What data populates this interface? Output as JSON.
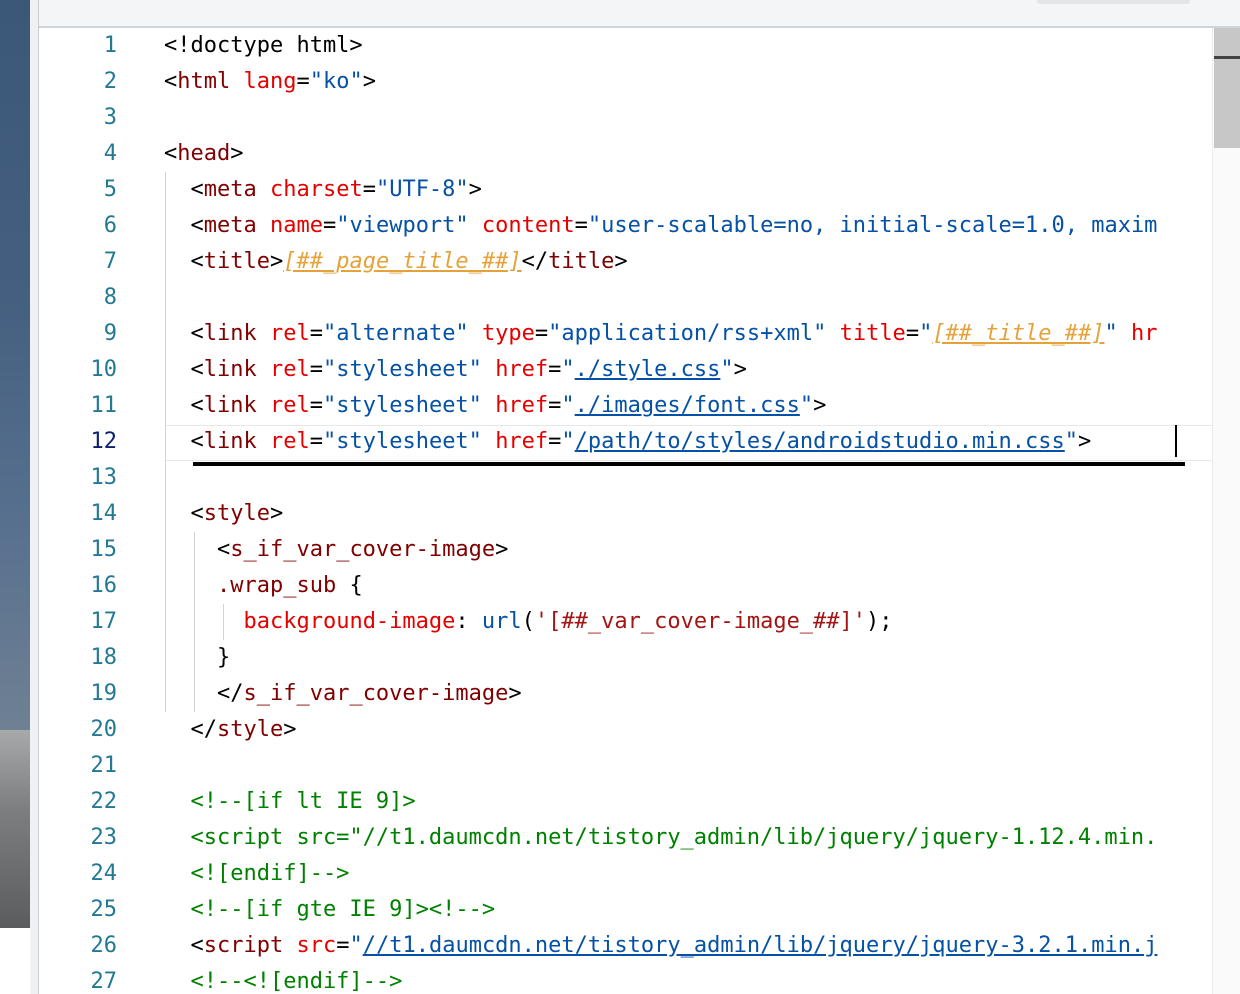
{
  "editor": {
    "lines": [
      {
        "n": "1",
        "tokens": [
          {
            "c": "k",
            "t": "<!doctype html>"
          }
        ]
      },
      {
        "n": "2",
        "tokens": [
          {
            "c": "k",
            "t": "<"
          },
          {
            "c": "t",
            "t": "html"
          },
          {
            "c": "k",
            "t": " "
          },
          {
            "c": "a",
            "t": "lang"
          },
          {
            "c": "k",
            "t": "="
          },
          {
            "c": "v",
            "t": "\"ko\""
          },
          {
            "c": "k",
            "t": ">"
          }
        ]
      },
      {
        "n": "3",
        "tokens": []
      },
      {
        "n": "4",
        "tokens": [
          {
            "c": "k",
            "t": "<"
          },
          {
            "c": "t",
            "t": "head"
          },
          {
            "c": "k",
            "t": ">"
          }
        ]
      },
      {
        "n": "5",
        "tokens": [
          {
            "c": "k",
            "t": "  <"
          },
          {
            "c": "t",
            "t": "meta"
          },
          {
            "c": "k",
            "t": " "
          },
          {
            "c": "a",
            "t": "charset"
          },
          {
            "c": "k",
            "t": "="
          },
          {
            "c": "v",
            "t": "\"UTF-8\""
          },
          {
            "c": "k",
            "t": ">"
          }
        ]
      },
      {
        "n": "6",
        "tokens": [
          {
            "c": "k",
            "t": "  <"
          },
          {
            "c": "t",
            "t": "meta"
          },
          {
            "c": "k",
            "t": " "
          },
          {
            "c": "a",
            "t": "name"
          },
          {
            "c": "k",
            "t": "="
          },
          {
            "c": "v",
            "t": "\"viewport\""
          },
          {
            "c": "k",
            "t": " "
          },
          {
            "c": "a",
            "t": "content"
          },
          {
            "c": "k",
            "t": "="
          },
          {
            "c": "v",
            "t": "\"user-scalable=no, initial-scale=1.0, maxim"
          }
        ]
      },
      {
        "n": "7",
        "tokens": [
          {
            "c": "k",
            "t": "  <"
          },
          {
            "c": "t",
            "t": "title"
          },
          {
            "c": "k",
            "t": ">"
          },
          {
            "c": "p",
            "t": "[##_page_title_##]"
          },
          {
            "c": "k",
            "t": "</"
          },
          {
            "c": "t",
            "t": "title"
          },
          {
            "c": "k",
            "t": ">"
          }
        ]
      },
      {
        "n": "8",
        "tokens": []
      },
      {
        "n": "9",
        "tokens": [
          {
            "c": "k",
            "t": "  <"
          },
          {
            "c": "t",
            "t": "link"
          },
          {
            "c": "k",
            "t": " "
          },
          {
            "c": "a",
            "t": "rel"
          },
          {
            "c": "k",
            "t": "="
          },
          {
            "c": "v",
            "t": "\"alternate\""
          },
          {
            "c": "k",
            "t": " "
          },
          {
            "c": "a",
            "t": "type"
          },
          {
            "c": "k",
            "t": "="
          },
          {
            "c": "v",
            "t": "\"application/rss+xml\""
          },
          {
            "c": "k",
            "t": " "
          },
          {
            "c": "a",
            "t": "title"
          },
          {
            "c": "k",
            "t": "="
          },
          {
            "c": "v",
            "t": "\""
          },
          {
            "c": "p",
            "t": "[##_title_##]"
          },
          {
            "c": "v",
            "t": "\""
          },
          {
            "c": "k",
            "t": " "
          },
          {
            "c": "a",
            "t": "hr"
          }
        ]
      },
      {
        "n": "10",
        "tokens": [
          {
            "c": "k",
            "t": "  <"
          },
          {
            "c": "t",
            "t": "link"
          },
          {
            "c": "k",
            "t": " "
          },
          {
            "c": "a",
            "t": "rel"
          },
          {
            "c": "k",
            "t": "="
          },
          {
            "c": "v",
            "t": "\"stylesheet\""
          },
          {
            "c": "k",
            "t": " "
          },
          {
            "c": "a",
            "t": "href"
          },
          {
            "c": "k",
            "t": "="
          },
          {
            "c": "v",
            "t": "\""
          },
          {
            "c": "l",
            "t": "./style.css"
          },
          {
            "c": "v",
            "t": "\""
          },
          {
            "c": "k",
            "t": ">"
          }
        ]
      },
      {
        "n": "11",
        "tokens": [
          {
            "c": "k",
            "t": "  <"
          },
          {
            "c": "t",
            "t": "link"
          },
          {
            "c": "k",
            "t": " "
          },
          {
            "c": "a",
            "t": "rel"
          },
          {
            "c": "k",
            "t": "="
          },
          {
            "c": "v",
            "t": "\"stylesheet\""
          },
          {
            "c": "k",
            "t": " "
          },
          {
            "c": "a",
            "t": "href"
          },
          {
            "c": "k",
            "t": "="
          },
          {
            "c": "v",
            "t": "\""
          },
          {
            "c": "l",
            "t": "./images/font.css"
          },
          {
            "c": "v",
            "t": "\""
          },
          {
            "c": "k",
            "t": ">"
          }
        ]
      },
      {
        "n": "12",
        "active": true,
        "tokens": [
          {
            "c": "k",
            "t": "  <"
          },
          {
            "c": "t",
            "t": "link"
          },
          {
            "c": "k",
            "t": " "
          },
          {
            "c": "a",
            "t": "rel"
          },
          {
            "c": "k",
            "t": "="
          },
          {
            "c": "v",
            "t": "\"stylesheet\""
          },
          {
            "c": "k",
            "t": " "
          },
          {
            "c": "a",
            "t": "href"
          },
          {
            "c": "k",
            "t": "="
          },
          {
            "c": "v",
            "t": "\""
          },
          {
            "c": "l",
            "t": "/path/to/styles/androidstudio.min.css"
          },
          {
            "c": "v",
            "t": "\""
          },
          {
            "c": "k",
            "t": ">"
          }
        ]
      },
      {
        "n": "13",
        "tokens": []
      },
      {
        "n": "14",
        "tokens": [
          {
            "c": "k",
            "t": "  <"
          },
          {
            "c": "t",
            "t": "style"
          },
          {
            "c": "k",
            "t": ">"
          }
        ]
      },
      {
        "n": "15",
        "tokens": [
          {
            "c": "k",
            "t": "    <"
          },
          {
            "c": "t",
            "t": "s_if_var_cover-image"
          },
          {
            "c": "k",
            "t": ">"
          }
        ]
      },
      {
        "n": "16",
        "tokens": [
          {
            "c": "k",
            "t": "    "
          },
          {
            "c": "t",
            "t": ".wrap_sub"
          },
          {
            "c": "k",
            "t": " {"
          }
        ]
      },
      {
        "n": "17",
        "tokens": [
          {
            "c": "k",
            "t": "      "
          },
          {
            "c": "a",
            "t": "background-image"
          },
          {
            "c": "k",
            "t": ": "
          },
          {
            "c": "v",
            "t": "url"
          },
          {
            "c": "k",
            "t": "("
          },
          {
            "c": "s",
            "t": "'[##_var_cover-image_##]'"
          },
          {
            "c": "k",
            "t": ");"
          }
        ]
      },
      {
        "n": "18",
        "tokens": [
          {
            "c": "k",
            "t": "    }"
          }
        ]
      },
      {
        "n": "19",
        "tokens": [
          {
            "c": "k",
            "t": "    </"
          },
          {
            "c": "t",
            "t": "s_if_var_cover-image"
          },
          {
            "c": "k",
            "t": ">"
          }
        ]
      },
      {
        "n": "20",
        "tokens": [
          {
            "c": "k",
            "t": "  </"
          },
          {
            "c": "t",
            "t": "style"
          },
          {
            "c": "k",
            "t": ">"
          }
        ]
      },
      {
        "n": "21",
        "tokens": []
      },
      {
        "n": "22",
        "tokens": [
          {
            "c": "c",
            "t": "  <!--[if lt IE 9]>"
          }
        ]
      },
      {
        "n": "23",
        "tokens": [
          {
            "c": "c",
            "t": "  <script src=\"//t1.daumcdn.net/tistory_admin/lib/jquery/jquery-1.12.4.min."
          }
        ]
      },
      {
        "n": "24",
        "tokens": [
          {
            "c": "c",
            "t": "  <![endif]-->"
          }
        ]
      },
      {
        "n": "25",
        "tokens": [
          {
            "c": "c",
            "t": "  <!--[if gte IE 9]><!-->"
          }
        ]
      },
      {
        "n": "26",
        "tokens": [
          {
            "c": "k",
            "t": "  <"
          },
          {
            "c": "t",
            "t": "script"
          },
          {
            "c": "k",
            "t": " "
          },
          {
            "c": "a",
            "t": "src"
          },
          {
            "c": "k",
            "t": "="
          },
          {
            "c": "v",
            "t": "\""
          },
          {
            "c": "l",
            "t": "//t1.daumcdn.net/tistory_admin/lib/jquery/jquery-3.2.1.min.j"
          }
        ]
      },
      {
        "n": "27",
        "tokens": [
          {
            "c": "c",
            "t": "  <!--<![endif]-->"
          }
        ]
      }
    ]
  },
  "icons": {
    "cursor": "text-cursor-icon"
  }
}
